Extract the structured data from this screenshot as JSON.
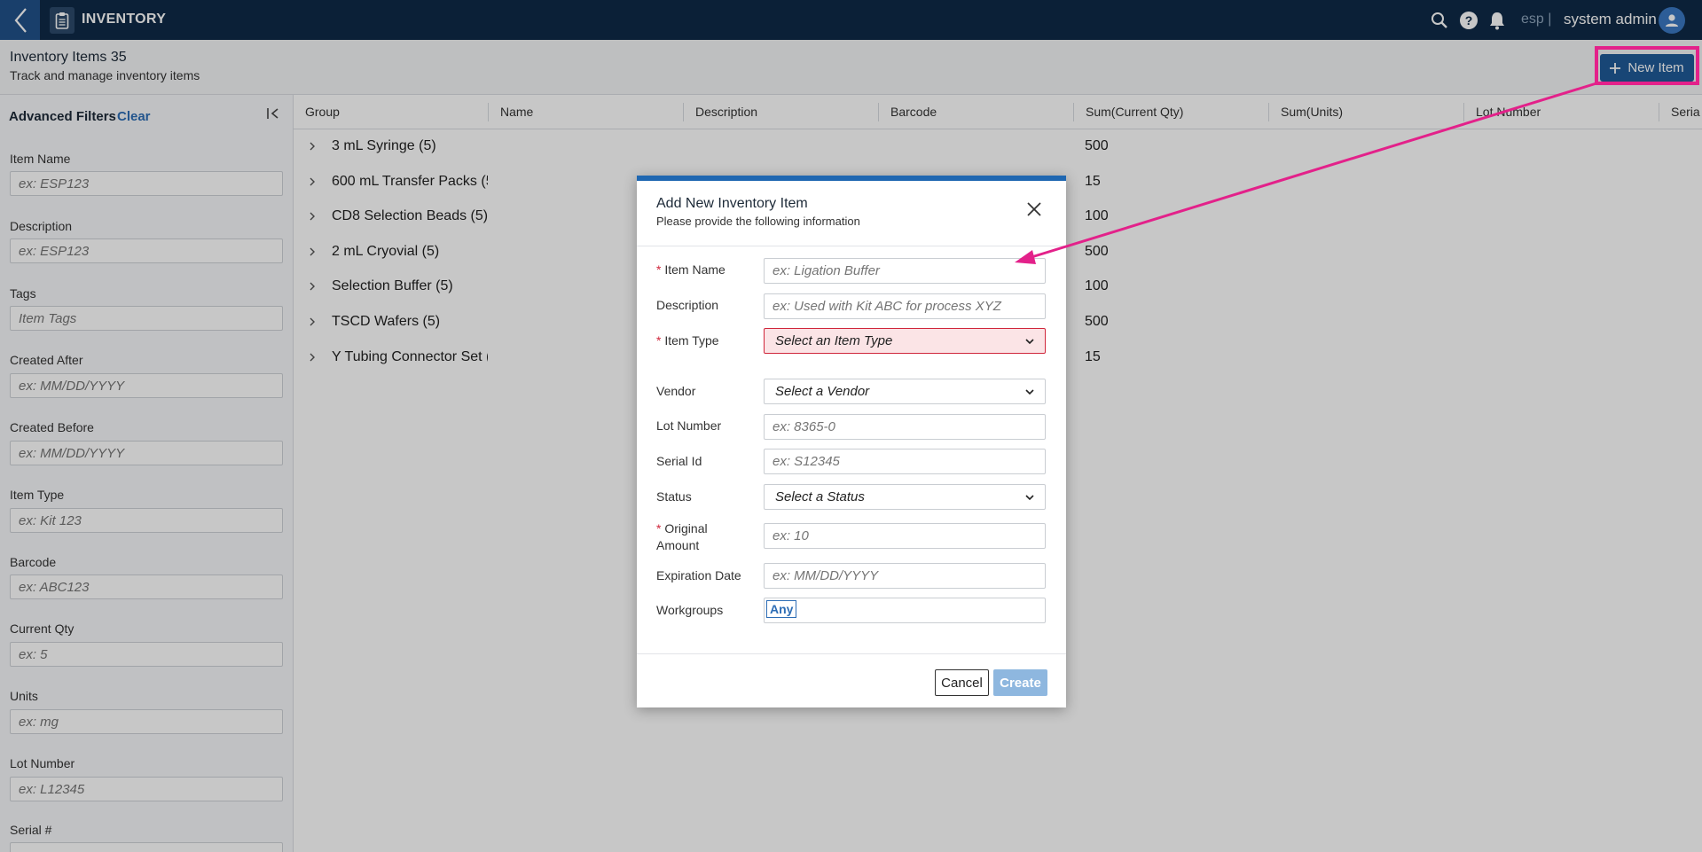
{
  "topbar": {
    "app_title": "INVENTORY",
    "env": "esp |",
    "user": "system admin",
    "icons": [
      "back-chevron-icon",
      "clipboard-icon",
      "search-icon",
      "help-icon",
      "bell-icon",
      "user-avatar-icon"
    ]
  },
  "header": {
    "title": "Inventory Items 35",
    "subtitle": "Track and manage inventory items",
    "new_item_label": "New Item"
  },
  "sidebar": {
    "title": "Advanced Filters",
    "clear": "Clear",
    "filters": [
      {
        "label": "Item Name",
        "placeholder": "ex: ESP123"
      },
      {
        "label": "Description",
        "placeholder": "ex: ESP123"
      },
      {
        "label": "Tags",
        "placeholder": "Item Tags"
      },
      {
        "label": "Created After",
        "placeholder": "ex: MM/DD/YYYY"
      },
      {
        "label": "Created Before",
        "placeholder": "ex: MM/DD/YYYY"
      },
      {
        "label": "Item Type",
        "placeholder": "ex: Kit 123"
      },
      {
        "label": "Barcode",
        "placeholder": "ex: ABC123"
      },
      {
        "label": "Current Qty",
        "placeholder": "ex: 5"
      },
      {
        "label": "Units",
        "placeholder": "ex: mg"
      },
      {
        "label": "Lot Number",
        "placeholder": "ex: L12345"
      },
      {
        "label": "Serial #",
        "placeholder": ""
      }
    ]
  },
  "table": {
    "columns": [
      "Group",
      "Name",
      "Description",
      "Barcode",
      "Sum(Current Qty)",
      "Sum(Units)",
      "Lot Number",
      "Seria"
    ],
    "rows": [
      {
        "group": "3 mL Syringe (5)",
        "qty": "500"
      },
      {
        "group": "600 mL Transfer Packs (5",
        "qty": "15"
      },
      {
        "group": "CD8 Selection Beads (5)",
        "qty": "100"
      },
      {
        "group": "2 mL Cryovial (5)",
        "qty": "500"
      },
      {
        "group": "Selection Buffer (5)",
        "qty": "100"
      },
      {
        "group": "TSCD Wafers (5)",
        "qty": "500"
      },
      {
        "group": "Y Tubing Connector Set (5",
        "qty": "15"
      }
    ]
  },
  "modal": {
    "title": "Add New Inventory Item",
    "subtitle": "Please provide the following information",
    "required_mark": "*",
    "fields": {
      "item_name": {
        "label": "Item Name",
        "placeholder": "ex: Ligation Buffer"
      },
      "description": {
        "label": "Description",
        "placeholder": "ex: Used with Kit ABC for process XYZ"
      },
      "item_type": {
        "label": "Item Type",
        "value": "Select an Item Type"
      },
      "vendor": {
        "label": "Vendor",
        "value": "Select a Vendor"
      },
      "lot_number": {
        "label": "Lot Number",
        "placeholder": "ex: 8365-0"
      },
      "serial_id": {
        "label": "Serial Id",
        "placeholder": "ex: S12345"
      },
      "status": {
        "label": "Status",
        "value": "Select a Status"
      },
      "original_amount": {
        "label_line1": "Original",
        "label_line2": "Amount",
        "placeholder": "ex: 10"
      },
      "expiration_date": {
        "label": "Expiration Date",
        "placeholder": "ex: MM/DD/YYYY"
      },
      "workgroups": {
        "label": "Workgroups",
        "chip": "Any"
      }
    },
    "cancel_label": "Cancel",
    "create_label": "Create"
  },
  "colors": {
    "topbar": "#0f2a47",
    "primary_button": "#1f5a98",
    "modal_accent": "#1f67b1",
    "annotation": "#e3218a",
    "error_fill": "#fbe4e6",
    "required": "#d0263b"
  }
}
